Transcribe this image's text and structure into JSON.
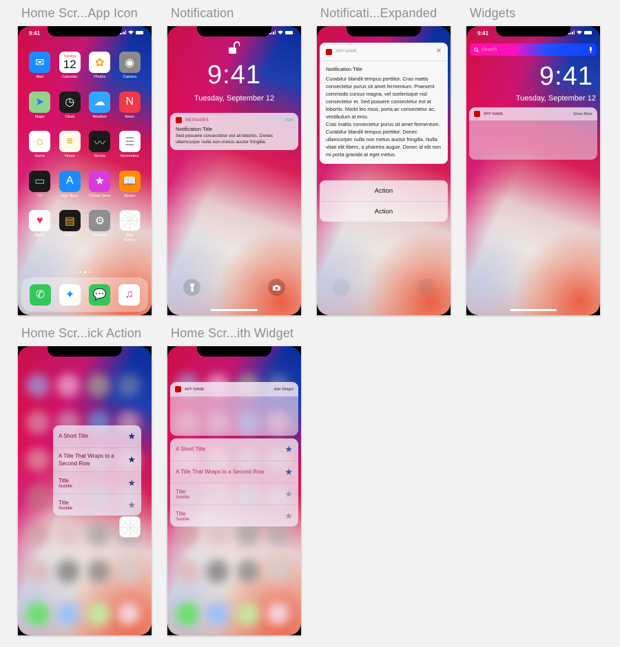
{
  "colors": {
    "canvas": "#f2f2f2",
    "title_gray": "#8e8e8e",
    "app_red": "#d00000",
    "quick_text": "#7a0a3a",
    "star_dark": "#1a2a6e",
    "star_mid": "#3a4a7e",
    "star_gray": "#7a7a8e"
  },
  "status": {
    "time": "9:41"
  },
  "artboards": [
    {
      "title": "Home Scr...App Icon"
    },
    {
      "title": "Notification"
    },
    {
      "title": "Notificati...Expanded"
    },
    {
      "title": "Widgets"
    },
    {
      "title": "Home Scr...ick Action"
    },
    {
      "title": "Home Scr...ith Widget"
    }
  ],
  "home": {
    "apps": [
      {
        "label": "Mail",
        "icon": "mail-icon",
        "glyph": "✉",
        "bg": "#1a8cff"
      },
      {
        "label": "Calendar",
        "icon": "calendar-icon",
        "glyph": "12",
        "sub": "Tuesday",
        "bg": "#ffffff"
      },
      {
        "label": "Photos",
        "icon": "photos-icon",
        "glyph": "✿",
        "bg": "#ffffff"
      },
      {
        "label": "Camera",
        "icon": "camera-icon",
        "glyph": "◉",
        "bg": "#8a8a8a"
      },
      {
        "label": "Maps",
        "icon": "maps-icon",
        "glyph": "➤",
        "bg": "#8fd48a"
      },
      {
        "label": "Clock",
        "icon": "clock-icon",
        "glyph": "◷",
        "bg": "#1c1c1c"
      },
      {
        "label": "Weather",
        "icon": "weather-icon",
        "glyph": "☁",
        "bg": "#2fa6ff"
      },
      {
        "label": "News",
        "icon": "news-icon",
        "glyph": "N",
        "bg": "#f0384a"
      },
      {
        "label": "Home",
        "icon": "home-icon",
        "glyph": "⌂",
        "bg": "#ffffff"
      },
      {
        "label": "Notes",
        "icon": "notes-icon",
        "glyph": "≡",
        "bg": "#fffbe8"
      },
      {
        "label": "Stocks",
        "icon": "stocks-icon",
        "glyph": "〰",
        "bg": "#1a1a1a"
      },
      {
        "label": "Reminders",
        "icon": "reminders-icon",
        "glyph": "☰",
        "bg": "#ffffff"
      },
      {
        "label": "TV",
        "icon": "tv-icon",
        "glyph": "▭",
        "bg": "#1a1a1a"
      },
      {
        "label": "App Store",
        "icon": "app-store-icon",
        "glyph": "A",
        "bg": "#1a8cff"
      },
      {
        "label": "iTunes Store",
        "icon": "itunes-store-icon",
        "glyph": "★",
        "bg": "#d63ae0"
      },
      {
        "label": "iBooks",
        "icon": "ibooks-icon",
        "glyph": "📖",
        "bg": "#ff8c00"
      },
      {
        "label": "Health",
        "icon": "health-icon",
        "glyph": "♥",
        "bg": "#ffffff"
      },
      {
        "label": "Wallet",
        "icon": "wallet-icon",
        "glyph": "▤",
        "bg": "#1a1a1a"
      },
      {
        "label": "Settings",
        "icon": "settings-icon",
        "glyph": "⚙",
        "bg": "#8e8e93"
      },
      {
        "label": "[App Name]",
        "icon": "app-placeholder-icon",
        "glyph": "",
        "bg": "#ffffff"
      }
    ],
    "dock": [
      {
        "label": "Phone",
        "icon": "phone-icon",
        "glyph": "✆",
        "bg": "#34c759"
      },
      {
        "label": "Safari",
        "icon": "safari-icon",
        "glyph": "✦",
        "bg": "#ffffff"
      },
      {
        "label": "Messages",
        "icon": "messages-icon",
        "glyph": "💬",
        "bg": "#34c759"
      },
      {
        "label": "Music",
        "icon": "music-icon",
        "glyph": "♫",
        "bg": "#ffffff"
      }
    ],
    "page_count": 3,
    "active_page": 1
  },
  "lock": {
    "time": "9:41",
    "date": "Tuesday, September 12"
  },
  "notification": {
    "app": "MESSAGES",
    "time": "now",
    "title": "Notification Title",
    "body": "Sed posuere consectetur est at lobortis. Donec ullamcorper nulla non metus auctor fringilla."
  },
  "expanded": {
    "app": "APP NAME",
    "title": "Notification Title",
    "body_1": "Curabitur blandit tempus porttitor. Cras mattis consectetur purus sit amet fermentum. Praesent commodo cursus magna, vel scelerisque nisl consectetur et. Sed posuere consectetur est at lobortis. Morbi leo risus, porta ac consectetur ac, vestibulum at eros.",
    "body_2": "Cras mattis consectetur purus sit amet fermentum. Curabitur blandit tempus porttitor. Donec ullamcorper nulla non metus auctor fringilla. Nulla vitae elit libero, a pharetra augue. Donec id elit non mi porta gravida at eget metus.",
    "actions": [
      "Action",
      "Action"
    ]
  },
  "widgets": {
    "search_placeholder": "Search",
    "app": "APP NAME",
    "show_more": "Show More"
  },
  "quick_action": {
    "items": [
      {
        "title": "A Short Title",
        "subtitle": "",
        "star": "dark"
      },
      {
        "title": "A Title That Wraps to a Second Row",
        "subtitle": "",
        "star": "dark"
      },
      {
        "title": "Title",
        "subtitle": "Subtitle",
        "star": "mid"
      },
      {
        "title": "Title",
        "subtitle": "Subtitle",
        "star": "gray"
      }
    ]
  },
  "home_widget": {
    "app": "APP NAME",
    "add_widget": "Add Widget",
    "items": [
      {
        "title": "A Short Title",
        "subtitle": ""
      },
      {
        "title": "A Title That Wraps to a Second Row",
        "subtitle": ""
      },
      {
        "title": "Title",
        "subtitle": "Subtitle"
      },
      {
        "title": "Title",
        "subtitle": "Subtitle"
      }
    ]
  }
}
